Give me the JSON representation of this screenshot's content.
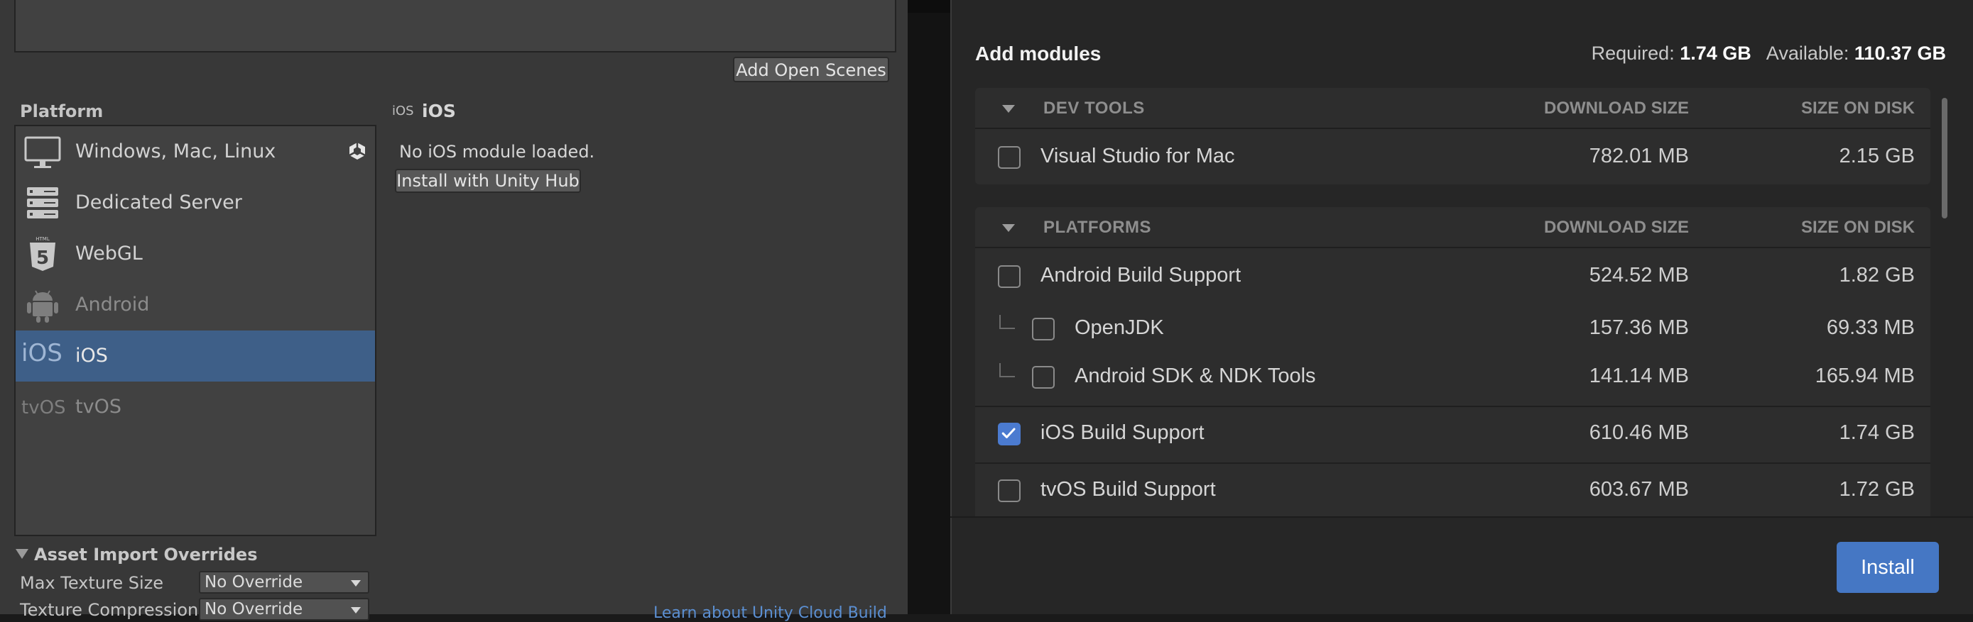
{
  "unity": {
    "add_open_scenes": "Add Open Scenes",
    "platform_label": "Platform",
    "platforms": [
      {
        "label": "Windows, Mac, Linux",
        "icon": "monitor-icon",
        "state": "normal"
      },
      {
        "label": "Dedicated Server",
        "icon": "server-icon",
        "state": "normal"
      },
      {
        "label": "WebGL",
        "icon": "html5-icon",
        "state": "normal"
      },
      {
        "label": "Android",
        "icon": "android-icon",
        "state": "dimmed"
      },
      {
        "label": "iOS",
        "icon": "ios-icon",
        "state": "selected",
        "icon_text": "iOS"
      },
      {
        "label": "tvOS",
        "icon": "tvos-icon",
        "state": "dimmed",
        "icon_text": "tvOS"
      }
    ],
    "detail": {
      "small_label": "iOS",
      "title": "iOS",
      "message": "No iOS module loaded.",
      "install_button": "Install with Unity Hub"
    },
    "asset_import": {
      "title": "Asset Import Overrides",
      "max_texture_label": "Max Texture Size",
      "max_texture_value": "No Override",
      "texture_compression_label": "Texture Compression",
      "texture_compression_value": "No Override"
    },
    "bottom_link": "Learn about Unity Cloud Build"
  },
  "hub": {
    "title": "Add modules",
    "required_label": "Required:",
    "required_value": "1.74 GB",
    "available_label": "Available:",
    "available_value": "110.37 GB",
    "install_button": "Install",
    "groups": [
      {
        "name": "DEV TOOLS",
        "col_download": "DOWNLOAD SIZE",
        "col_disk": "SIZE ON DISK",
        "modules": [
          {
            "name": "Visual Studio for Mac",
            "download": "782.01 MB",
            "disk": "2.15 GB",
            "checked": false,
            "child": false
          }
        ]
      },
      {
        "name": "PLATFORMS",
        "col_download": "DOWNLOAD SIZE",
        "col_disk": "SIZE ON DISK",
        "modules": [
          {
            "name": "Android Build Support",
            "download": "524.52 MB",
            "disk": "1.82 GB",
            "checked": false,
            "child": false
          },
          {
            "name": "OpenJDK",
            "download": "157.36 MB",
            "disk": "69.33 MB",
            "checked": false,
            "child": true
          },
          {
            "name": "Android SDK & NDK Tools",
            "download": "141.14 MB",
            "disk": "165.94 MB",
            "checked": false,
            "child": true
          },
          {
            "name": "iOS Build Support",
            "download": "610.46 MB",
            "disk": "1.74 GB",
            "checked": true,
            "child": false
          },
          {
            "name": "tvOS Build Support",
            "download": "603.67 MB",
            "disk": "1.72 GB",
            "checked": false,
            "child": false
          }
        ]
      }
    ]
  },
  "colors": {
    "unity_bg": "#383838",
    "selection": "#3e5f88",
    "hub_bg": "#262626",
    "accent": "#4577c4"
  }
}
